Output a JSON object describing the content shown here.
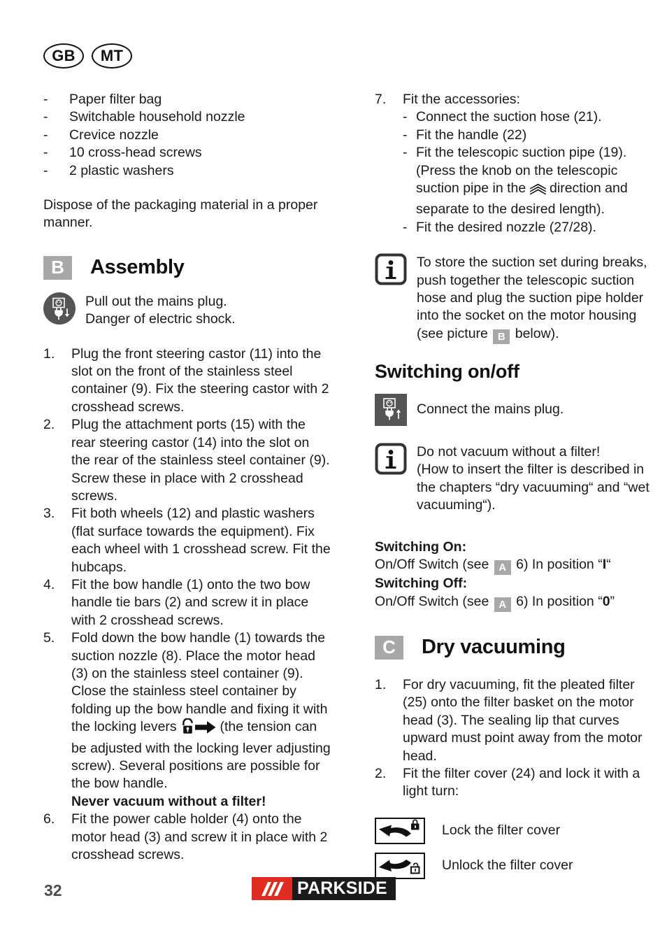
{
  "country_badges": [
    {
      "code": "GB"
    },
    {
      "code": "MT"
    }
  ],
  "left_column": {
    "parts_list": [
      {
        "marker": "-",
        "text": "Paper filter bag"
      },
      {
        "marker": "-",
        "text": "Switchable household nozzle"
      },
      {
        "marker": "-",
        "text": "Crevice nozzle"
      },
      {
        "marker": "-",
        "text": "10 cross-head screws"
      },
      {
        "marker": "-",
        "text": "2 plastic washers"
      }
    ],
    "dispose_note": "Dispose of the packaging material in a proper manner.",
    "assembly_section": {
      "badge": "B",
      "title": "Assembly",
      "warning": {
        "icon": "plug-pull-out-icon",
        "line1": "Pull out the mains plug.",
        "line2": "Danger of electric shock."
      },
      "steps": [
        {
          "number": "1.",
          "text": "Plug the front steering castor (11) into the slot on the front of the stainless steel container (9). Fix the steering castor with 2 crosshead screws."
        },
        {
          "number": "2.",
          "text": "Plug the attachment ports (15) with the rear steering castor (14) into the slot on the rear of the stainless steel container (9). Screw these in place with 2 crosshead screws."
        },
        {
          "number": "3.",
          "text": "Fit both wheels (12) and plastic washers (flat surface towards the equipment). Fix each wheel with 1 crosshead screw. Fit the hubcaps."
        },
        {
          "number": "4.",
          "text": "Fit the bow handle (1) onto the two bow handle tie bars (2) and screw it in place with 2 crosshead screws."
        },
        {
          "number": "5.",
          "text_before_icons": "Fold down the bow handle (1) towards the suction nozzle (8). Place the motor head (3) on the stainless steel container (9). Close the stainless steel container by folding up the bow handle and fixing it with the locking levers ",
          "text_after_icons": " (the tension can be adjusted with the locking lever adjusting screw). Several positions are possible for the bow handle.",
          "bold_note": "Never vacuum without a filter!"
        },
        {
          "number": "6.",
          "text": "Fit the power cable holder (4) onto the motor head (3) and screw it in place with 2 crosshead screws."
        }
      ]
    }
  },
  "right_column": {
    "step7": {
      "number": "7.",
      "heading": "Fit the accessories:",
      "sub_items": [
        {
          "marker": "-",
          "text": "Connect the suction hose (21)."
        },
        {
          "marker": "-",
          "text": "Fit the handle (22)"
        },
        {
          "marker": "-",
          "text_before_icon": "Fit the telescopic suction pipe (19). (Press the knob on the telescopic suction pipe in the ",
          "text_after_icon": " direction and separate to the desired length)."
        },
        {
          "marker": "-",
          "text": "Fit the desired nozzle (27/28)."
        }
      ]
    },
    "info_store": {
      "icon": "info-icon",
      "text_before_badge": "To store the suction set during breaks, push together the telescopic suction hose and plug the suction pipe holder into the socket on the motor housing (see picture ",
      "badge": "B",
      "text_after_badge": " below)."
    },
    "switching_section": {
      "title": "Switching on/off",
      "connect_note": {
        "icon": "plug-connect-icon",
        "text": "Connect the mains plug."
      },
      "filter_info": {
        "icon": "info-icon",
        "line1": "Do not vacuum without a filter!",
        "line2": "(How to insert the filter is described in the chapters “dry vacuuming“ and “wet vacuuming“)."
      },
      "switching_on": {
        "label": "Switching On:",
        "text_before_badge": "On/Off Switch (see ",
        "badge": "A",
        "text_after_badge": " 6) In position “",
        "position": "I",
        "text_end": "“"
      },
      "switching_off": {
        "label": "Switching Off:",
        "text_before_badge": "On/Off Switch (see ",
        "badge": "A",
        "text_after_badge": " 6) In position “",
        "position": "0",
        "text_end": "”"
      }
    },
    "dry_vacuuming_section": {
      "badge": "C",
      "title": "Dry vacuuming",
      "steps": [
        {
          "number": "1.",
          "text": "For dry vacuuming, fit the pleated filter (25) onto the filter basket on the motor head (3). The sealing lip that curves upward must point away from the motor head."
        },
        {
          "number": "2.",
          "text": "Fit the filter cover (24) and lock it with a light turn:"
        }
      ],
      "lock_rows": [
        {
          "icon": "lock-closed-arrow-icon",
          "label": "Lock the filter cover"
        },
        {
          "icon": "lock-open-arrow-icon",
          "label": "Unlock the filter cover"
        }
      ]
    }
  },
  "footer": {
    "page_number": "32",
    "brand": "PARKSIDE"
  },
  "colors": {
    "badge_gray": "#a8a8a8",
    "icon_dark": "#555555",
    "brand_red": "#e02b20",
    "brand_dark": "#1b1b1b",
    "text": "#1a1a1a"
  }
}
